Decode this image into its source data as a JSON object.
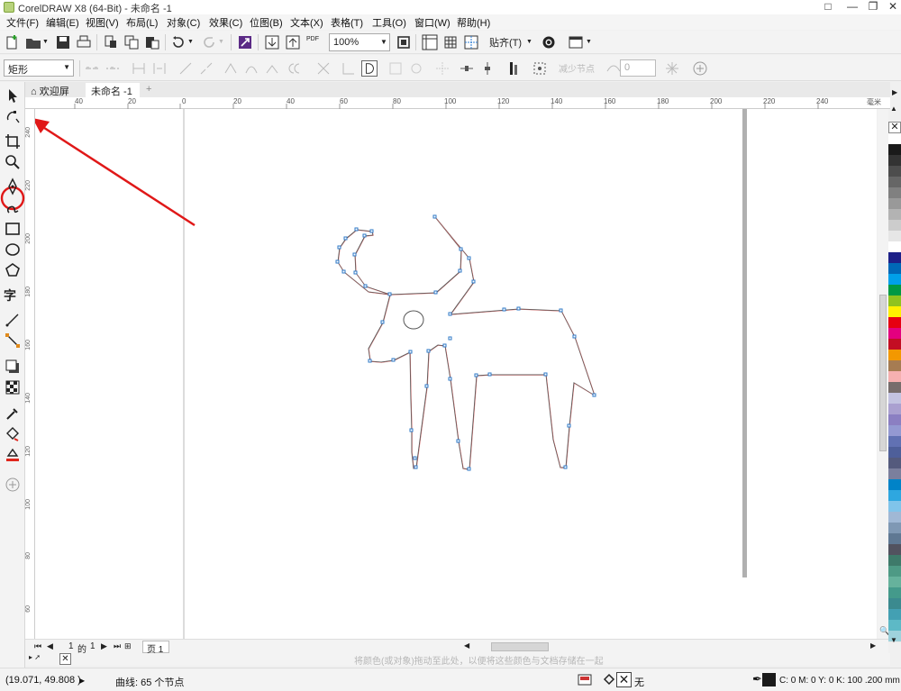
{
  "window": {
    "title": "CorelDRAW X8 (64-Bit) - 未命名 -1"
  },
  "menu": [
    "文件(F)",
    "编辑(E)",
    "视图(V)",
    "布局(L)",
    "对象(C)",
    "效果(C)",
    "位图(B)",
    "文本(X)",
    "表格(T)",
    "工具(O)",
    "窗口(W)",
    "帮助(H)"
  ],
  "toolbar": {
    "zoom_value": "100%",
    "snap_label": "贴齐(T)",
    "pdf_label": "PDF"
  },
  "propbar": {
    "shape_type": "矩形",
    "reduce_nodes_label": "减少节点",
    "smooth_value": "0"
  },
  "tabs": {
    "welcome": "欢迎屏幕",
    "document": "未命名 -1"
  },
  "ruler": {
    "h_labels": [
      "40",
      "20",
      "0",
      "20",
      "40",
      "60",
      "80",
      "100",
      "120",
      "140",
      "160",
      "180",
      "200",
      "220",
      "240",
      "毫米"
    ],
    "v_labels": [
      "240",
      "220",
      "200",
      "180",
      "160",
      "140",
      "120",
      "100",
      "80",
      "60",
      "40"
    ]
  },
  "pages": {
    "current": "1",
    "of_label": "的",
    "total": "1",
    "page_tab": "页 1"
  },
  "hint": "将颜色(或对象)拖动至此处，以便将这些颜色与文档存储在一起",
  "status": {
    "coords": "(19.071, 49.808 )",
    "object_info": "曲线: 65 个节点",
    "fill_none": "无",
    "color_info": "C: 0 M: 0 Y: 0 K: 100  .200 mm"
  },
  "palette_colors": [
    "#ffffff",
    "#1a1a1a",
    "#333333",
    "#4d4d4d",
    "#666666",
    "#808080",
    "#999999",
    "#b3b3b3",
    "#cccccc",
    "#e6e6e6",
    "#ffffff",
    "#1d2088",
    "#0068b7",
    "#00a0e9",
    "#009944",
    "#8fc31f",
    "#fff100",
    "#e60012",
    "#e4007f",
    "#c30d23",
    "#f39800",
    "#a67c52",
    "#f6b0b0",
    "#776d6c",
    "#c3c3e1",
    "#aaa0d0",
    "#8b7fc2",
    "#9499d2",
    "#6171b3",
    "#4e5f9a",
    "#545a7d",
    "#7b7f9d",
    "#0083c8",
    "#2ea7e0",
    "#80c4ea",
    "#a0b8d5",
    "#7f98b4",
    "#5f7893",
    "#52525f",
    "#3e7a6a",
    "#4e9a85",
    "#66b29c",
    "#449a8b",
    "#3b8a8f",
    "#43a0b3",
    "#5db9c6",
    "#9fd2dc"
  ],
  "colors": {
    "accent": "#2477c9",
    "annotation": "#e01818",
    "node": "#2e78c7"
  }
}
